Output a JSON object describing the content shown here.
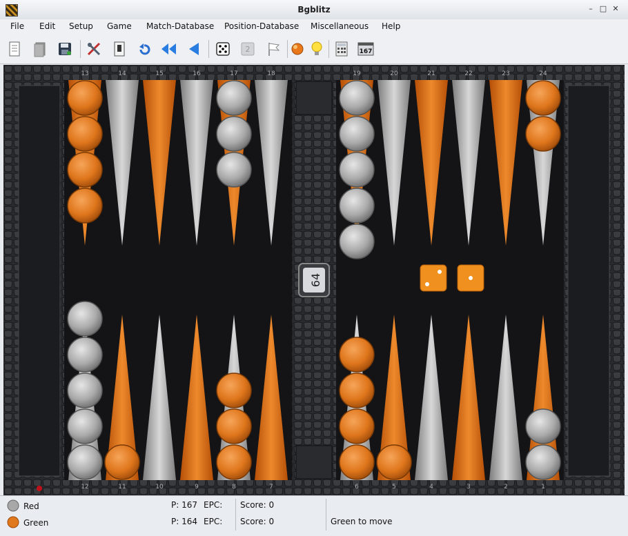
{
  "window": {
    "title": "Bgblitz"
  },
  "menu": [
    "File",
    "Edit",
    "Setup",
    "Game",
    "Match-Database",
    "Position-Database",
    "Miscellaneous",
    "Help"
  ],
  "toolbar": {
    "icons": [
      "new-match-icon",
      "open-icon",
      "save-icon",
      "settings-tools-icon",
      "import-icon",
      "undo-icon",
      "rewind-icon",
      "back-icon",
      "dice-icon",
      "double-cube-icon",
      "resign-flag-icon",
      "hint-ball-icon",
      "tip-lightbulb-icon",
      "calculator-icon",
      "pipcount-icon"
    ],
    "cube_value": "2",
    "pip_badge": "167"
  },
  "board": {
    "top_point_numbers": [
      "13",
      "14",
      "15",
      "16",
      "17",
      "18",
      "19",
      "20",
      "21",
      "22",
      "23",
      "24"
    ],
    "bottom_point_numbers": [
      "12",
      "11",
      "10",
      "9",
      "8",
      "7",
      "6",
      "5",
      "4",
      "3",
      "2",
      "1"
    ],
    "doubling_cube": "64",
    "dice": [
      2,
      1
    ],
    "colors": {
      "orange": "#e07a1e",
      "silver": "#b8b8b8",
      "felt": "#141416",
      "frame": "#2a2b2e"
    },
    "checkers": [
      {
        "point": 13,
        "color": "orange",
        "count": 4
      },
      {
        "point": 17,
        "color": "silver",
        "count": 3
      },
      {
        "point": 19,
        "color": "silver",
        "count": 5
      },
      {
        "point": 24,
        "color": "orange",
        "count": 2
      },
      {
        "point": 12,
        "color": "silver",
        "count": 5
      },
      {
        "point": 11,
        "color": "orange",
        "count": 1
      },
      {
        "point": 8,
        "color": "orange",
        "count": 3
      },
      {
        "point": 6,
        "color": "orange",
        "count": 4
      },
      {
        "point": 5,
        "color": "orange",
        "count": 1
      },
      {
        "point": 1,
        "color": "silver",
        "count": 2
      }
    ]
  },
  "status": {
    "player1": {
      "name": "Red",
      "pips": "P: 167",
      "epc": "EPC:",
      "score": "Score: 0"
    },
    "player2": {
      "name": "Green",
      "pips": "P: 164",
      "epc": "EPC:",
      "score": "Score: 0"
    },
    "message": "Green to move"
  }
}
